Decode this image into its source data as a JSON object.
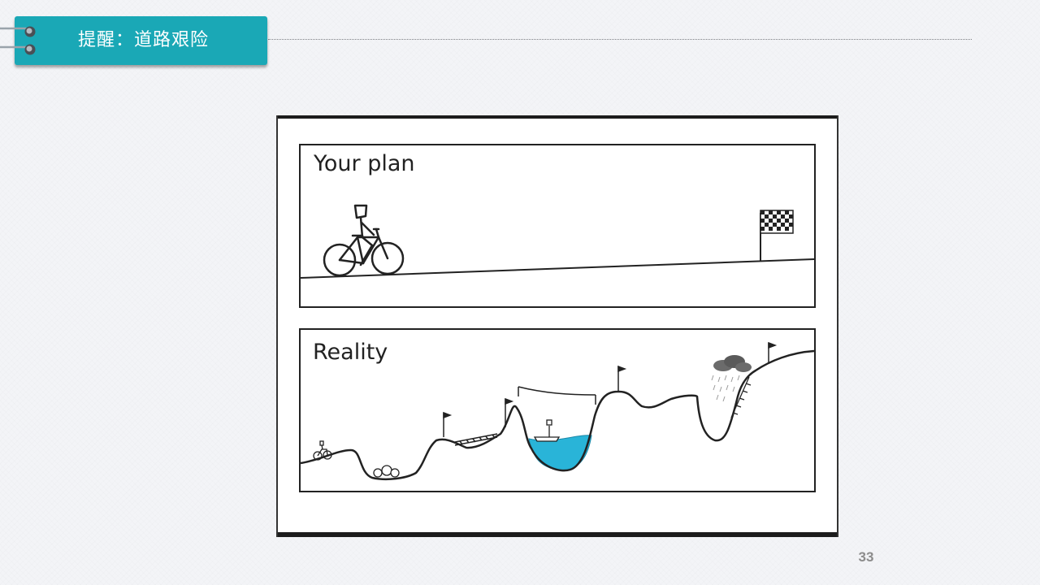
{
  "slide": {
    "title": "提醒：道路艰险",
    "page_number": "33",
    "accent_color": "#1aa8b6"
  },
  "comic": {
    "panel_top_label": "Your plan",
    "panel_bottom_label": "Reality",
    "icons": [
      "cyclist-icon",
      "checkered-flag-icon",
      "flag-icon",
      "rocks-icon",
      "boat-icon",
      "storm-cloud-icon"
    ]
  }
}
